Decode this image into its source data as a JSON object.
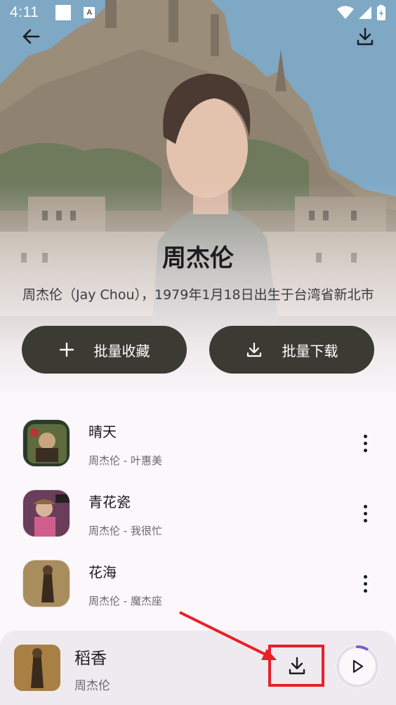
{
  "status_bar": {
    "time": "4:11",
    "a_icon": "A"
  },
  "header": {
    "back_icon": "arrow-left-icon",
    "download_icon": "download-icon"
  },
  "artist": {
    "name": "周杰伦",
    "description": "周杰伦（Jay Chou），1979年1月18日出生于台湾省新北市"
  },
  "actions": {
    "collect_label": "批量收藏",
    "download_label": "批量下载"
  },
  "songs": [
    {
      "title": "晴天",
      "subtitle": "周杰伦 - 叶惠美"
    },
    {
      "title": "青花瓷",
      "subtitle": "周杰伦 - 我很忙"
    },
    {
      "title": "花海",
      "subtitle": "周杰伦 - 魔杰座"
    }
  ],
  "player": {
    "title": "稻香",
    "artist": "周杰伦",
    "progress": 0.08
  },
  "colors": {
    "button_bg": "#3b3a33",
    "accent": "#7a5cc7",
    "highlight": "#e8202a"
  }
}
